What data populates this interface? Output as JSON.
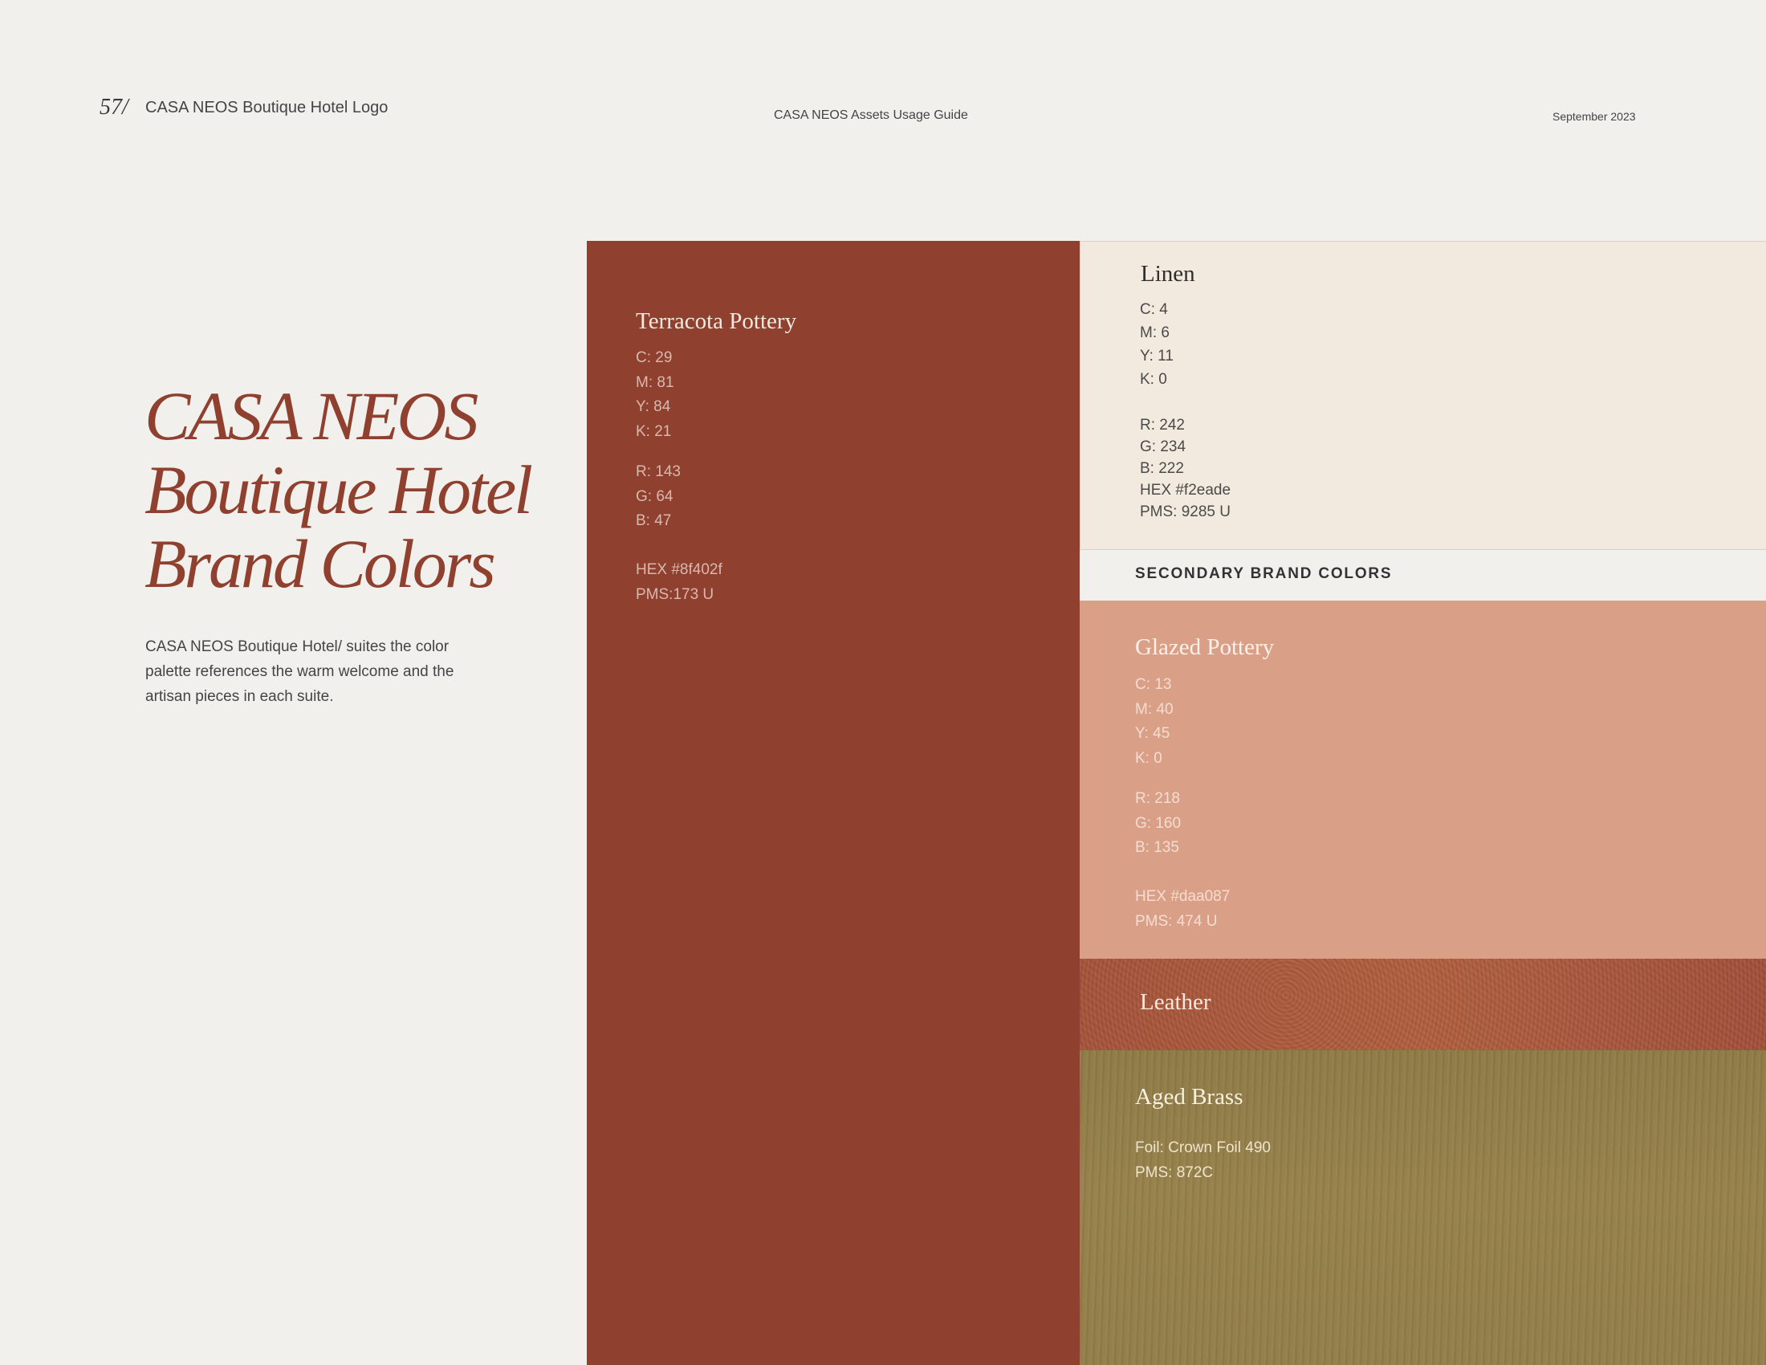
{
  "header": {
    "page_number": "57/",
    "section_title": "CASA NEOS Boutique Hotel Logo",
    "guide_title": "CASA NEOS Assets Usage Guide",
    "date": "September 2023"
  },
  "intro": {
    "heading_lines": [
      "CASA NEOS",
      "Boutique Hotel",
      "Brand Colors"
    ],
    "description": "CASA NEOS Boutique Hotel/ suites the color palette references the warm welcome and the artisan pieces in each suite."
  },
  "primary_colors": {
    "terracotta": {
      "name": "Terracota Pottery",
      "swatch_color": "#8f402f",
      "cmyk": [
        "C: 29",
        "M: 81",
        "Y: 84",
        "K: 21"
      ],
      "rgb": [
        "R: 143",
        "G: 64",
        "B: 47"
      ],
      "hex": "HEX #8f402f",
      "pms": "PMS:173 U"
    },
    "linen": {
      "name": "Linen",
      "swatch_color": "#f2eade",
      "cmyk": [
        "C: 4",
        "M: 6",
        "Y: 11",
        "K: 0"
      ],
      "rgb": [
        "R: 242",
        "G: 234",
        "B: 222"
      ],
      "hex": "HEX #f2eade",
      "pms": "PMS: 9285 U"
    }
  },
  "secondary_label": "SECONDARY BRAND COLORS",
  "secondary_colors": {
    "glazed": {
      "name": "Glazed Pottery",
      "swatch_color": "#daa087",
      "cmyk": [
        "C: 13",
        "M: 40",
        "Y: 45",
        "K: 0"
      ],
      "rgb": [
        "R: 218",
        "G: 160",
        "B: 135"
      ],
      "hex": "HEX #daa087",
      "pms": "PMS: 474 U"
    },
    "leather": {
      "name": "Leather",
      "swatch_color": "#a9583c"
    },
    "brass": {
      "name": "Aged Brass",
      "swatch_color": "#927d48",
      "foil": "Foil: Crown Foil 490",
      "pms": "PMS: 872C"
    }
  }
}
